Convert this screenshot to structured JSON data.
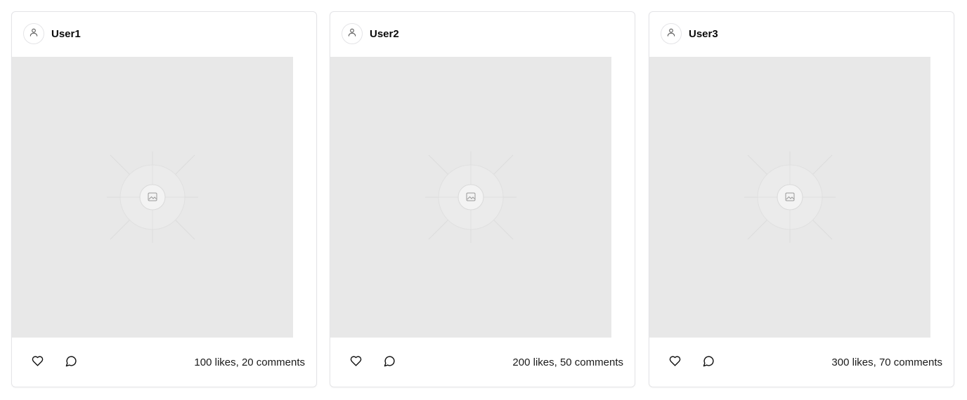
{
  "posts": [
    {
      "user": {
        "name": "User1",
        "avatar_icon": "user-icon"
      },
      "image": {
        "placeholder_icon": "image-icon"
      },
      "actions": {
        "like_icon": "heart-icon",
        "comment_icon": "message-circle-icon"
      },
      "stats": "100 likes, 20 comments"
    },
    {
      "user": {
        "name": "User2",
        "avatar_icon": "user-icon"
      },
      "image": {
        "placeholder_icon": "image-icon"
      },
      "actions": {
        "like_icon": "heart-icon",
        "comment_icon": "message-circle-icon"
      },
      "stats": "200 likes, 50 comments"
    },
    {
      "user": {
        "name": "User3",
        "avatar_icon": "user-icon"
      },
      "image": {
        "placeholder_icon": "image-icon"
      },
      "actions": {
        "like_icon": "heart-icon",
        "comment_icon": "message-circle-icon"
      },
      "stats": "300 likes, 70 comments"
    }
  ],
  "colors": {
    "image_placeholder": "#e8e8e8",
    "card_border": "#e4e4e7"
  }
}
